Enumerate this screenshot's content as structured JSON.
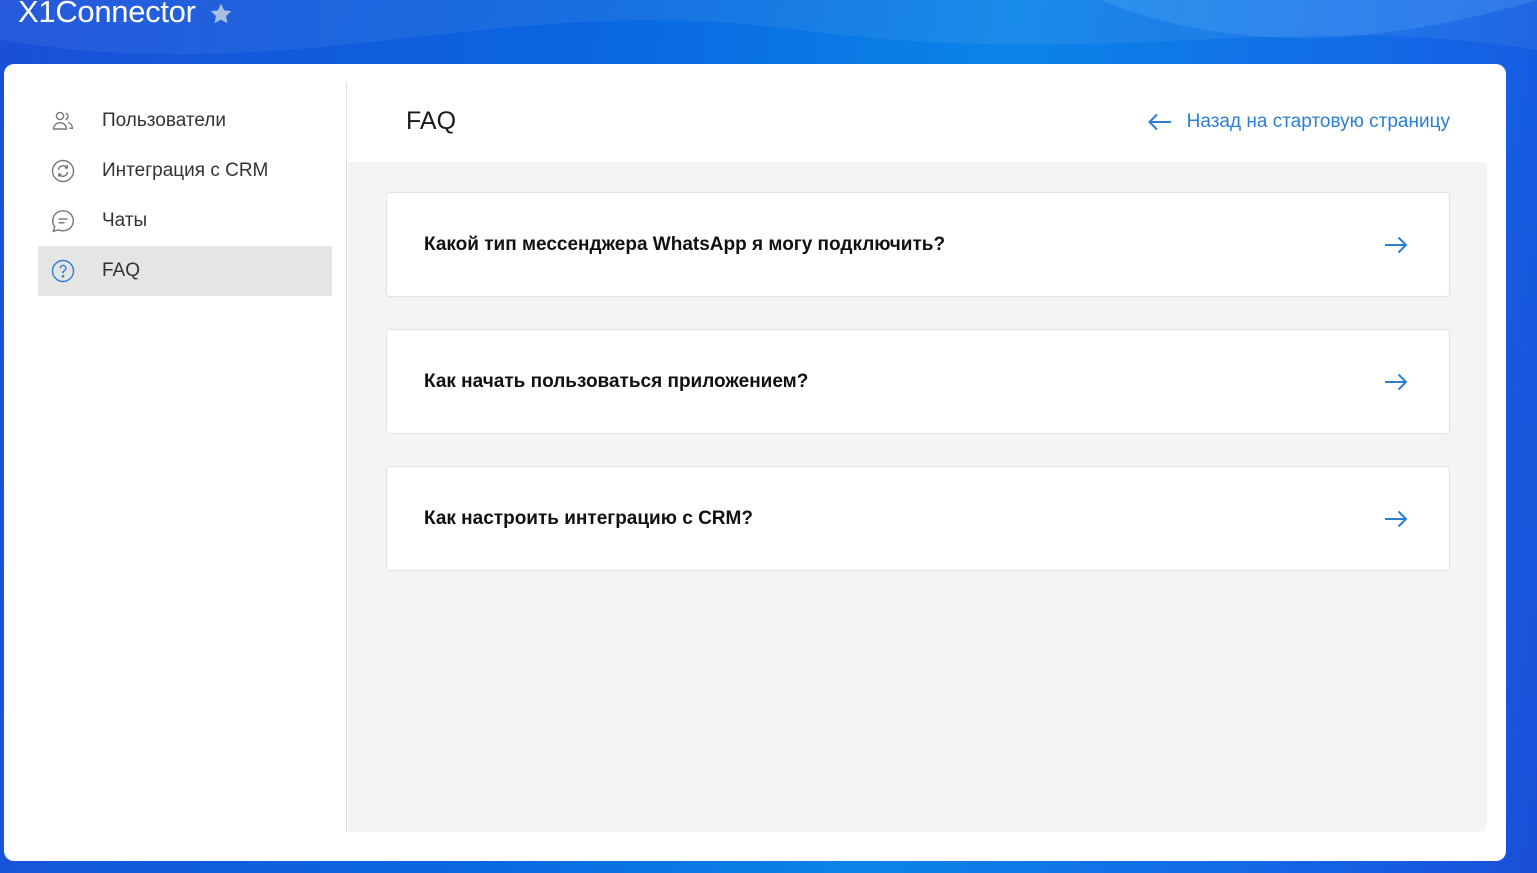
{
  "app": {
    "title": "X1Connector",
    "favorite_icon": "star-icon"
  },
  "colors": {
    "accent": "#2a7fd4",
    "active_nav_bg": "#e5e5e5",
    "main_bg": "#f4f4f4",
    "background_blue": "#0a66e0"
  },
  "sidebar": {
    "items": [
      {
        "label": "Пользователи",
        "icon": "users-icon",
        "active": false
      },
      {
        "label": "Интеграция с CRM",
        "icon": "sync-icon",
        "active": false
      },
      {
        "label": "Чаты",
        "icon": "chat-icon",
        "active": false
      },
      {
        "label": "FAQ",
        "icon": "question-icon",
        "active": true
      }
    ]
  },
  "main": {
    "title": "FAQ",
    "back_link": "Назад на стартовую страницу",
    "faq_items": [
      {
        "question": "Какой тип мессенджера WhatsApp я могу подключить?"
      },
      {
        "question": "Как начать пользоваться приложением?"
      },
      {
        "question": "Как настроить интеграцию с CRM?"
      }
    ]
  }
}
